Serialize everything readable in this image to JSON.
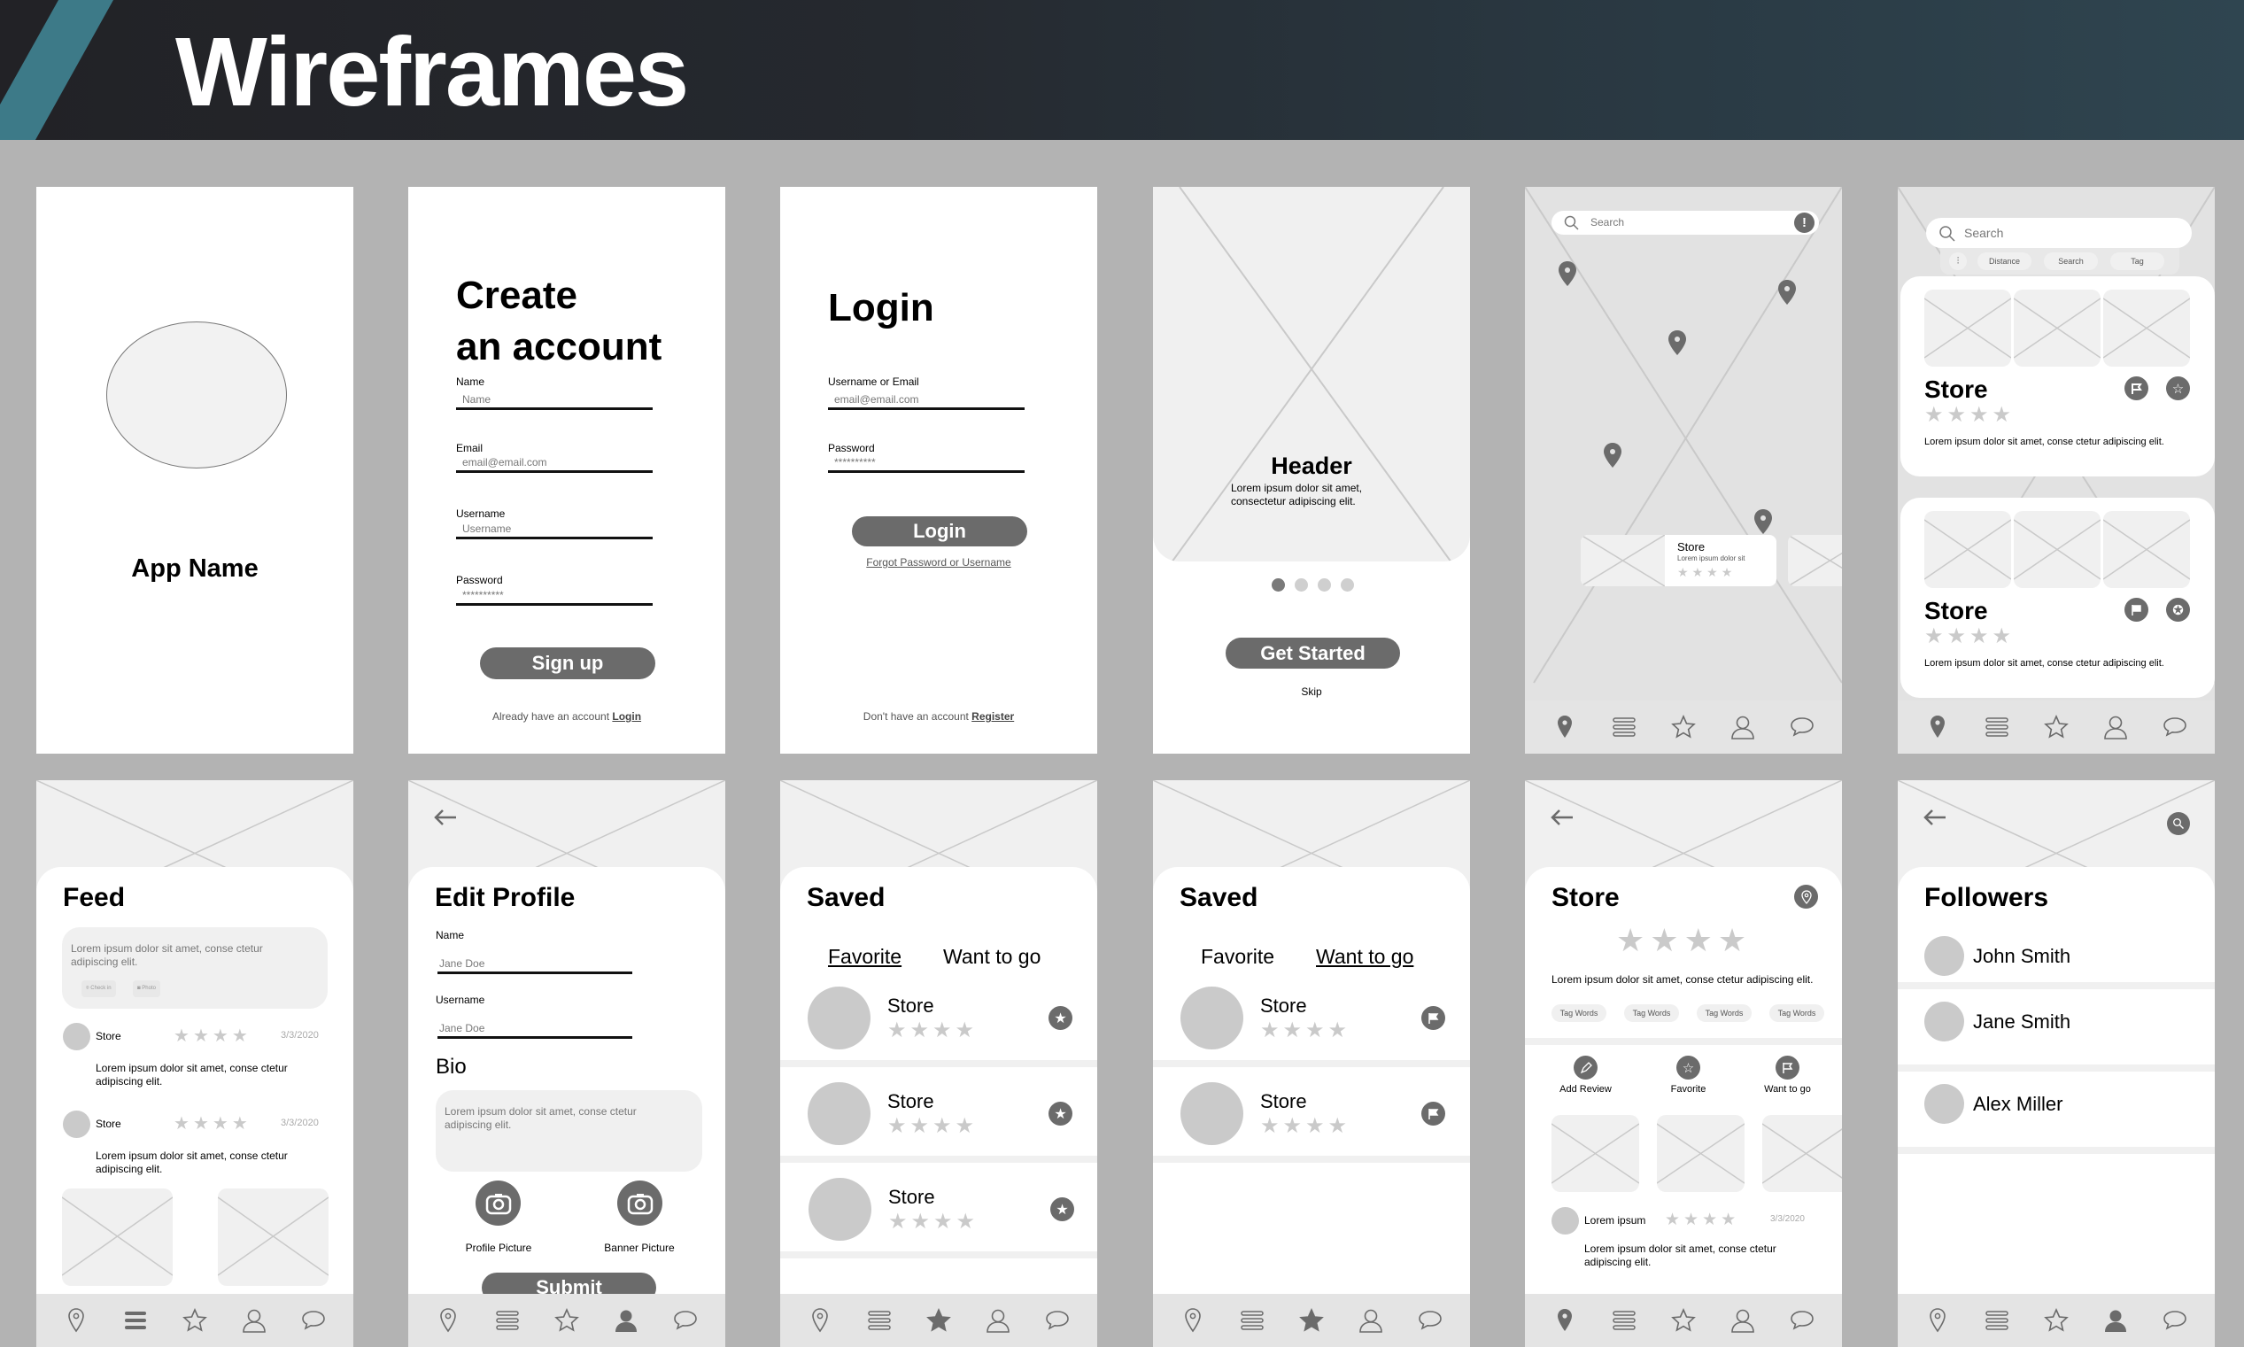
{
  "page_title": "Wireframes",
  "colors": {
    "banner_stripe": "#3d7a88",
    "button": "#6b6b6b",
    "placeholder_bg": "#f0f0f0",
    "star_inactive": "#cacaca",
    "navbar_bg": "#e4e4e4",
    "canvas_bg": "#b3b3b3"
  },
  "splash": {
    "app_name": "App Name"
  },
  "create_account": {
    "title_line1": "Create",
    "title_line2": "an account",
    "fields": [
      {
        "label": "Name",
        "placeholder": "Name"
      },
      {
        "label": "Email",
        "placeholder": "email@email.com"
      },
      {
        "label": "Username",
        "placeholder": "Username"
      },
      {
        "label": "Password",
        "placeholder": "**********"
      }
    ],
    "signup_button": "Sign up",
    "footer_text": "Already have an account",
    "footer_link": "Login"
  },
  "login": {
    "title": "Login",
    "fields": [
      {
        "label": "Username or Email",
        "placeholder": "email@email.com"
      },
      {
        "label": "Password",
        "placeholder": "**********"
      }
    ],
    "login_button": "Login",
    "forgot_link": "Forgot Password or Username",
    "footer_text": "Don't have an account",
    "footer_link": "Register"
  },
  "onboarding": {
    "header": "Header",
    "body": "Lorem ipsum dolor sit amet, consectetur adipiscing elit.",
    "page_indicator": {
      "current": 1,
      "total": 4
    },
    "get_started_button": "Get Started",
    "skip_link": "Skip"
  },
  "map": {
    "search_placeholder": "Search",
    "alert_icon": "!",
    "card": {
      "title": "Store",
      "subtitle": "Lorem ipsum dolor sit",
      "rating": 4
    }
  },
  "search_results": {
    "search_placeholder": "Search",
    "filters": [
      "Distance",
      "Search",
      "Tag"
    ],
    "results": [
      {
        "title": "Store",
        "rating": 4,
        "description": "Lorem ipsum dolor sit amet, conse ctetur adipiscing elit."
      },
      {
        "title": "Store",
        "rating": 4,
        "description": "Lorem ipsum dolor sit amet, conse ctetur adipiscing elit."
      }
    ]
  },
  "feed": {
    "title": "Feed",
    "composer_text": "Lorem ipsum dolor sit amet, conse ctetur adipiscing elit.",
    "composer_actions": [
      "Check in",
      "Photo"
    ],
    "posts": [
      {
        "name": "Store",
        "rating": 4,
        "date": "3/3/2020",
        "text": "Lorem ipsum dolor sit amet, conse ctetur adipiscing elit."
      },
      {
        "name": "Store",
        "rating": 4,
        "date": "3/3/2020",
        "text": "Lorem ipsum dolor sit amet, conse ctetur adipiscing elit."
      }
    ]
  },
  "edit_profile": {
    "title": "Edit Profile",
    "fields": [
      {
        "label": "Name",
        "value": "Jane Doe"
      },
      {
        "label": "Username",
        "value": "Jane Doe"
      }
    ],
    "bio_label": "Bio",
    "bio_text": "Lorem ipsum dolor sit amet, conse ctetur adipiscing elit.",
    "profile_picture_label": "Profile Picture",
    "banner_picture_label": "Banner Picture",
    "submit_button": "Submit"
  },
  "saved_favorite": {
    "title": "Saved",
    "tabs": [
      "Favorite",
      "Want to go"
    ],
    "active_tab": "Favorite",
    "items": [
      {
        "name": "Store",
        "rating": 4
      },
      {
        "name": "Store",
        "rating": 4
      },
      {
        "name": "Store",
        "rating": 4
      }
    ]
  },
  "saved_want": {
    "title": "Saved",
    "tabs": [
      "Favorite",
      "Want to go"
    ],
    "active_tab": "Want to go",
    "items": [
      {
        "name": "Store",
        "rating": 4
      },
      {
        "name": "Store",
        "rating": 4
      }
    ]
  },
  "store_detail": {
    "title": "Store",
    "rating": 4,
    "description": "Lorem ipsum dolor sit amet, conse ctetur adipiscing elit.",
    "tags": [
      "Tag Words",
      "Tag Words",
      "Tag Words",
      "Tag Words"
    ],
    "actions": [
      "Add Review",
      "Favorite",
      "Want to go"
    ],
    "review": {
      "name": "Lorem ipsum",
      "rating": 4,
      "date": "3/3/2020",
      "text": "Lorem ipsum dolor sit amet, conse ctetur adipiscing elit."
    }
  },
  "followers": {
    "title": "Followers",
    "people": [
      "John Smith",
      "Jane Smith",
      "Alex Miller"
    ]
  },
  "navbar": [
    "map-pin",
    "list",
    "star",
    "profile",
    "chat"
  ]
}
